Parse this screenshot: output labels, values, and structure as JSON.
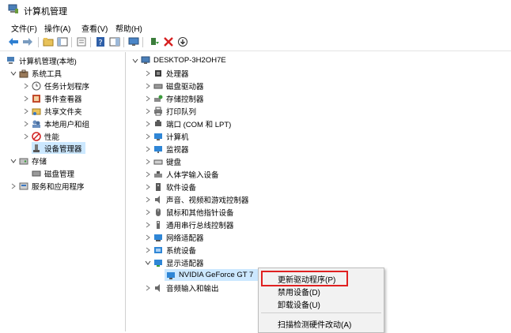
{
  "window": {
    "title": "计算机管理"
  },
  "menu": [
    "文件(F)",
    "操作(A)",
    "查看(V)",
    "帮助(H)"
  ],
  "toolbar": {
    "icons": [
      "back-arrow-icon",
      "forward-arrow-icon",
      "up-folder-icon",
      "show-hide-tree-icon",
      "properties-icon",
      "help-icon",
      "action-pane-icon",
      "monitor-icon",
      "update-driver-icon",
      "uninstall-icon",
      "download-icon"
    ]
  },
  "left_tree": [
    {
      "label": "计算机管理(本地)"
    },
    {
      "label": "系统工具"
    },
    {
      "label": "任务计划程序"
    },
    {
      "label": "事件查看器"
    },
    {
      "label": "共享文件夹"
    },
    {
      "label": "本地用户和组"
    },
    {
      "label": "性能"
    },
    {
      "label": "设备管理器"
    },
    {
      "label": "存储"
    },
    {
      "label": "磁盘管理"
    },
    {
      "label": "服务和应用程序"
    }
  ],
  "device_tree": {
    "root": "DESKTOP-3H2OH7E",
    "categories": [
      "处理器",
      "磁盘驱动器",
      "存储控制器",
      "打印队列",
      "端口 (COM 和 LPT)",
      "计算机",
      "监视器",
      "键盘",
      "人体学输入设备",
      "软件设备",
      "声音、视频和游戏控制器",
      "鼠标和其他指针设备",
      "通用串行总线控制器",
      "网络适配器",
      "系统设备",
      "显示适配器"
    ],
    "selected_device": "NVIDIA GeForce GT 7",
    "after": "音频输入和输出"
  },
  "context_menu": {
    "items": [
      "更新驱动程序(P)",
      "禁用设备(D)",
      "卸载设备(U)",
      "扫描检测硬件改动(A)"
    ]
  },
  "colors": {
    "selection": "#cce8ff",
    "highlight_border": "#e02020"
  }
}
